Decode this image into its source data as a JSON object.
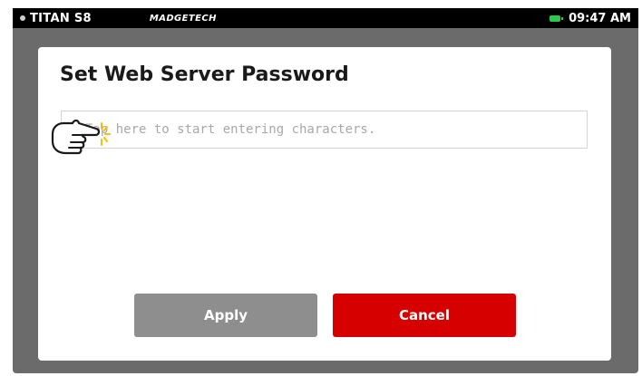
{
  "status_bar": {
    "device_name": "TITAN S8",
    "brand": "MADGETECH",
    "time": "09:47 AM",
    "battery_color": "#2fc74a"
  },
  "dialog": {
    "title": "Set Web Server Password",
    "input": {
      "placeholder": "Tap here to start entering characters.",
      "value": ""
    },
    "buttons": {
      "apply_label": "Apply",
      "cancel_label": "Cancel"
    },
    "colors": {
      "apply": "#8e8e8e",
      "cancel": "#d60000"
    }
  },
  "overlay": {
    "pointer_icon": "pointing-hand-icon"
  }
}
